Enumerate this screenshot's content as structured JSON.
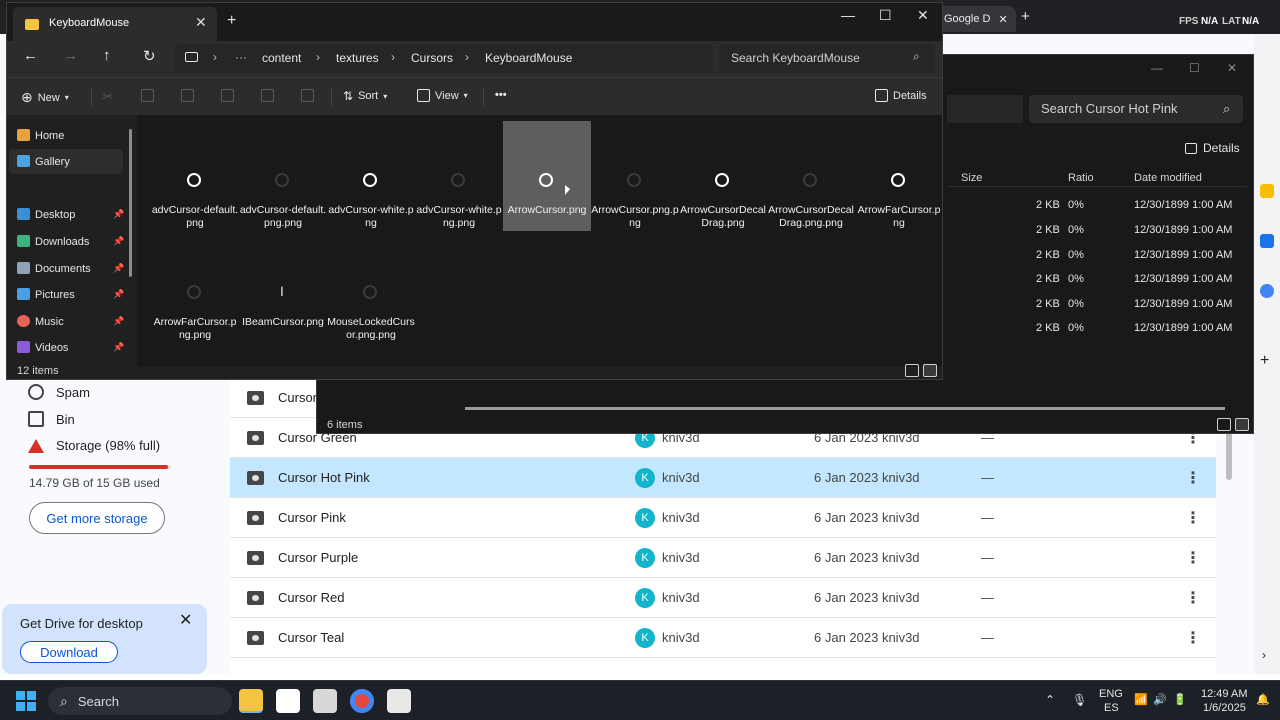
{
  "chrome": {
    "tab_label": "Google D",
    "right_labels": {
      "fps": "FPS",
      "fps_value": "N/A",
      "lat": "LAT",
      "lat_value": "N/A"
    }
  },
  "drive": {
    "nav": [
      {
        "label": "Spam",
        "icon": "spam-icon"
      },
      {
        "label": "Bin",
        "icon": "bin-icon"
      },
      {
        "label": "Storage (98% full)",
        "icon": "storage-icon"
      }
    ],
    "storage_percent": 98,
    "storage_text": "14.79 GB of 15 GB used",
    "get_storage_label": "Get more storage",
    "promo_title": "Get Drive for desktop",
    "promo_button": "Download",
    "rows": [
      {
        "name": "Cursor",
        "owner": "",
        "modified": "",
        "size": ""
      },
      {
        "name": "Cursor Green",
        "owner_initial": "K",
        "owner": "kniv3d",
        "modified": "6 Jan 2023 kniv3d",
        "size": "—"
      },
      {
        "name": "Cursor Hot Pink",
        "owner_initial": "K",
        "owner": "kniv3d",
        "modified": "6 Jan 2023 kniv3d",
        "size": "—"
      },
      {
        "name": "Cursor Pink",
        "owner_initial": "K",
        "owner": "kniv3d",
        "modified": "6 Jan 2023 kniv3d",
        "size": "—"
      },
      {
        "name": "Cursor Purple",
        "owner_initial": "K",
        "owner": "kniv3d",
        "modified": "6 Jan 2023 kniv3d",
        "size": "—"
      },
      {
        "name": "Cursor Red",
        "owner_initial": "K",
        "owner": "kniv3d",
        "modified": "6 Jan 2023 kniv3d",
        "size": "—"
      },
      {
        "name": "Cursor Teal",
        "owner_initial": "K",
        "owner": "kniv3d",
        "modified": "6 Jan 2023 kniv3d",
        "size": "—"
      }
    ]
  },
  "explorer2": {
    "search_placeholder": "Search Cursor Hot Pink",
    "details_label": "Details",
    "columns": {
      "size": "Size",
      "ratio": "Ratio",
      "date": "Date modified"
    },
    "rows": [
      {
        "size": "2 KB",
        "ratio": "0%",
        "date": "12/30/1899 1:00 AM"
      },
      {
        "size": "2 KB",
        "ratio": "0%",
        "date": "12/30/1899 1:00 AM"
      },
      {
        "size": "2 KB",
        "ratio": "0%",
        "date": "12/30/1899 1:00 AM"
      },
      {
        "size": "2 KB",
        "ratio": "0%",
        "date": "12/30/1899 1:00 AM"
      },
      {
        "size": "2 KB",
        "ratio": "0%",
        "date": "12/30/1899 1:00 AM"
      },
      {
        "size": "2 KB",
        "ratio": "0%",
        "date": "12/30/1899 1:00 AM"
      }
    ],
    "status": "6 items"
  },
  "explorer": {
    "tab_title": "KeyboardMouse",
    "breadcrumb": [
      "content",
      "textures",
      "Cursors",
      "KeyboardMouse"
    ],
    "search_placeholder": "Search KeyboardMouse",
    "toolbar": {
      "new": "New",
      "sort": "Sort",
      "view": "View",
      "more": "•••",
      "details": "Details"
    },
    "nav": [
      {
        "label": "Home",
        "color": "#e8a33d"
      },
      {
        "label": "Gallery",
        "color": "#4aa3df"
      },
      {
        "label": "Desktop",
        "color": "#3b8fd9"
      },
      {
        "label": "Downloads",
        "color": "#3fb37f"
      },
      {
        "label": "Documents",
        "color": "#8fa3b8"
      },
      {
        "label": "Pictures",
        "color": "#4a9ee8"
      },
      {
        "label": "Music",
        "color": "#e2655a"
      },
      {
        "label": "Videos",
        "color": "#8c5bd6"
      }
    ],
    "files": [
      {
        "name": "advCursor-default.png",
        "thumb": "white"
      },
      {
        "name": "advCursor-default.png.png",
        "thumb": "dark"
      },
      {
        "name": "advCursor-white.png",
        "thumb": "white"
      },
      {
        "name": "advCursor-white.png.png",
        "thumb": "dark"
      },
      {
        "name": "ArrowCursor.png",
        "thumb": "white"
      },
      {
        "name": "ArrowCursor.png.png",
        "thumb": "dark"
      },
      {
        "name": "ArrowCursorDecalDrag.png",
        "thumb": "white"
      },
      {
        "name": "ArrowCursorDecalDrag.png.png",
        "thumb": "dark"
      },
      {
        "name": "ArrowFarCursor.png",
        "thumb": "white"
      },
      {
        "name": "ArrowFarCursor.png.png",
        "thumb": "dark"
      },
      {
        "name": "IBeamCursor.png",
        "thumb": "ibeam"
      },
      {
        "name": "MouseLockedCursor.png.png",
        "thumb": "dark"
      }
    ],
    "status": "12 items"
  },
  "taskbar": {
    "search": "Search",
    "lang": "ENG",
    "lang2": "ES",
    "time": "12:49 AM",
    "date": "1/6/2025"
  }
}
